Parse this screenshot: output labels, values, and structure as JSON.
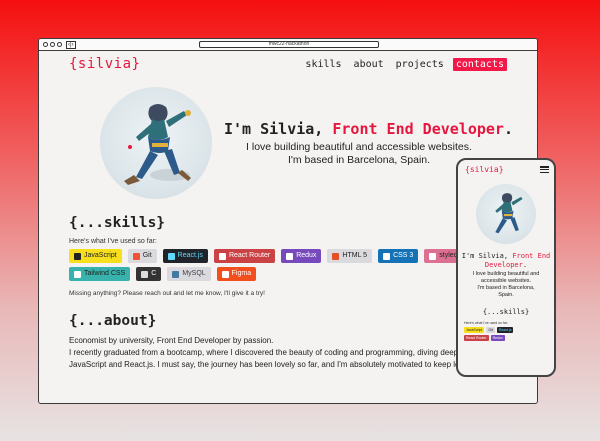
{
  "browser": {
    "url": "mwc22-hackathon",
    "nav_arrows": "‹|›"
  },
  "site": {
    "logo": "{silvia}",
    "nav": [
      {
        "label": "skills"
      },
      {
        "label": "about"
      },
      {
        "label": "projects"
      },
      {
        "label": "contacts"
      }
    ],
    "hero": {
      "title_prefix": "I'm Silvia, ",
      "title_accent": "Front End Developer",
      "title_suffix": ".",
      "line1": "I love building beautiful and accessible websites.",
      "line2": "I'm based in Barcelona, Spain."
    },
    "skills": {
      "title": "{...skills}",
      "intro": "Here's what I've used so far:",
      "badges": [
        {
          "label": "JavaScript",
          "bg": "#f7df1e",
          "fg": "#222",
          "icon": "#222"
        },
        {
          "label": "Git",
          "bg": "#d9d9de",
          "fg": "#222",
          "icon": "#f05033"
        },
        {
          "label": "React.js",
          "bg": "#20232a",
          "fg": "#61dafb",
          "icon": "#61dafb"
        },
        {
          "label": "React Router",
          "bg": "#ca4245",
          "fg": "#fff",
          "icon": "#fff"
        },
        {
          "label": "Redux",
          "bg": "#764abc",
          "fg": "#fff",
          "icon": "#fff"
        },
        {
          "label": "HTML 5",
          "bg": "#d9d9de",
          "fg": "#222",
          "icon": "#e34f26"
        },
        {
          "label": "CSS 3",
          "bg": "#1572b6",
          "fg": "#fff",
          "icon": "#fff"
        },
        {
          "label": "styled",
          "bg": "#db7093",
          "fg": "#222",
          "icon": "#fff"
        },
        {
          "label": "Tailwind CSS",
          "bg": "#38b2ac",
          "fg": "#222",
          "icon": "#fff"
        },
        {
          "label": "C",
          "bg": "#333",
          "fg": "#fff",
          "icon": "#ddd"
        },
        {
          "label": "MySQL",
          "bg": "#d9d9de",
          "fg": "#444",
          "icon": "#4479a1"
        },
        {
          "label": "Figma",
          "bg": "#f24e1e",
          "fg": "#fff",
          "icon": "#fff"
        }
      ],
      "missing": "Missing anything? Please reach out and let me know, I'll give it a try!"
    },
    "about": {
      "title": "{...about}",
      "p1": "Economist by university, Front End Developer by passion.",
      "p2": "I recently graduated from a bootcamp, where I discovered the beauty of coding and programming, diving deep into JavaScript and React.js. I must say, the journey has been lovely so far, and I'm absolutely motivated to keep learning"
    }
  },
  "mobile": {
    "logo": "{silvia}",
    "title_prefix": "I'm Silvia, ",
    "title_accent": "Front End Developer",
    "title_suffix": ".",
    "sub1": "I love building beautiful and",
    "sub2": "accessible websites.",
    "sub3": "I'm based in Barcelona,",
    "sub4": "Spain.",
    "skills_title": "{...skills}",
    "skills_intro": "Here's what I've used so far:",
    "badges": [
      {
        "label": "JavaScript",
        "bg": "#f7df1e",
        "fg": "#222"
      },
      {
        "label": "Git",
        "bg": "#d9d9de",
        "fg": "#222"
      },
      {
        "label": "React.js",
        "bg": "#20232a",
        "fg": "#61dafb"
      },
      {
        "label": "React Router",
        "bg": "#ca4245",
        "fg": "#fff"
      },
      {
        "label": "Redux",
        "bg": "#764abc",
        "fg": "#fff"
      }
    ]
  }
}
